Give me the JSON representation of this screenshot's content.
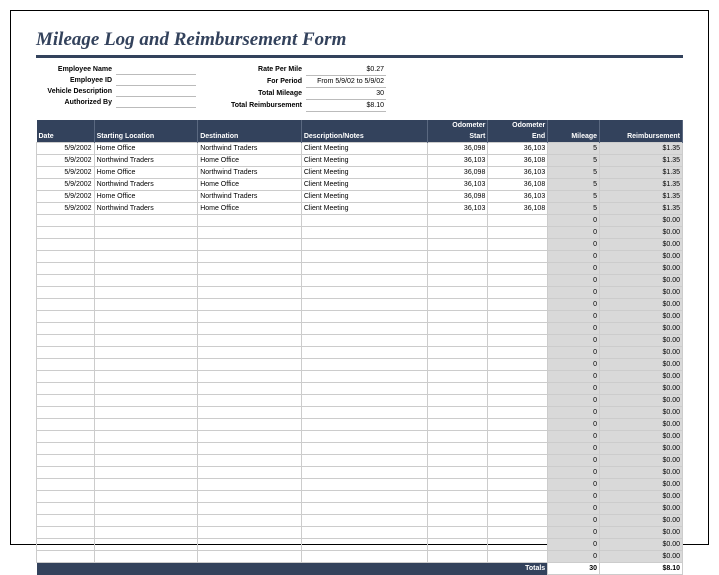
{
  "title": "Mileage Log and Reimbursement Form",
  "labels": {
    "employee_name": "Employee Name",
    "employee_id": "Employee ID",
    "vehicle_description": "Vehicle Description",
    "authorized_by": "Authorized By",
    "rate_per_mile": "Rate Per Mile",
    "for_period": "For Period",
    "total_mileage": "Total Mileage",
    "total_reimbursement": "Total Reimbursement"
  },
  "values": {
    "employee_name": "",
    "employee_id": "",
    "vehicle_description": "",
    "authorized_by": "",
    "rate_per_mile": "$0.27",
    "for_period": "From 5/9/02 to 5/9/02",
    "total_mileage": "30",
    "total_reimbursement": "$8.10"
  },
  "columns": {
    "date": "Date",
    "start": "Starting Location",
    "dest": "Destination",
    "desc": "Description/Notes",
    "ostart": "Odometer Start",
    "oend": "Odometer End",
    "mileage": "Mileage",
    "reimb": "Reimbursement"
  },
  "rows": [
    {
      "date": "5/9/2002",
      "start": "Home Office",
      "dest": "Northwind Traders",
      "desc": "Client Meeting",
      "ostart": "36,098",
      "oend": "36,103",
      "mileage": "5",
      "reimb": "$1.35"
    },
    {
      "date": "5/9/2002",
      "start": "Northwind Traders",
      "dest": "Home Office",
      "desc": "Client Meeting",
      "ostart": "36,103",
      "oend": "36,108",
      "mileage": "5",
      "reimb": "$1.35"
    },
    {
      "date": "5/9/2002",
      "start": "Home Office",
      "dest": "Northwind Traders",
      "desc": "Client Meeting",
      "ostart": "36,098",
      "oend": "36,103",
      "mileage": "5",
      "reimb": "$1.35"
    },
    {
      "date": "5/9/2002",
      "start": "Northwind Traders",
      "dest": "Home Office",
      "desc": "Client Meeting",
      "ostart": "36,103",
      "oend": "36,108",
      "mileage": "5",
      "reimb": "$1.35"
    },
    {
      "date": "5/9/2002",
      "start": "Home Office",
      "dest": "Northwind Traders",
      "desc": "Client Meeting",
      "ostart": "36,098",
      "oend": "36,103",
      "mileage": "5",
      "reimb": "$1.35"
    },
    {
      "date": "5/9/2002",
      "start": "Northwind Traders",
      "dest": "Home Office",
      "desc": "Client Meeting",
      "ostart": "36,103",
      "oend": "36,108",
      "mileage": "5",
      "reimb": "$1.35"
    },
    {
      "date": "",
      "start": "",
      "dest": "",
      "desc": "",
      "ostart": "",
      "oend": "",
      "mileage": "0",
      "reimb": "$0.00"
    },
    {
      "date": "",
      "start": "",
      "dest": "",
      "desc": "",
      "ostart": "",
      "oend": "",
      "mileage": "0",
      "reimb": "$0.00"
    },
    {
      "date": "",
      "start": "",
      "dest": "",
      "desc": "",
      "ostart": "",
      "oend": "",
      "mileage": "0",
      "reimb": "$0.00"
    },
    {
      "date": "",
      "start": "",
      "dest": "",
      "desc": "",
      "ostart": "",
      "oend": "",
      "mileage": "0",
      "reimb": "$0.00"
    },
    {
      "date": "",
      "start": "",
      "dest": "",
      "desc": "",
      "ostart": "",
      "oend": "",
      "mileage": "0",
      "reimb": "$0.00"
    },
    {
      "date": "",
      "start": "",
      "dest": "",
      "desc": "",
      "ostart": "",
      "oend": "",
      "mileage": "0",
      "reimb": "$0.00"
    },
    {
      "date": "",
      "start": "",
      "dest": "",
      "desc": "",
      "ostart": "",
      "oend": "",
      "mileage": "0",
      "reimb": "$0.00"
    },
    {
      "date": "",
      "start": "",
      "dest": "",
      "desc": "",
      "ostart": "",
      "oend": "",
      "mileage": "0",
      "reimb": "$0.00"
    },
    {
      "date": "",
      "start": "",
      "dest": "",
      "desc": "",
      "ostart": "",
      "oend": "",
      "mileage": "0",
      "reimb": "$0.00"
    },
    {
      "date": "",
      "start": "",
      "dest": "",
      "desc": "",
      "ostart": "",
      "oend": "",
      "mileage": "0",
      "reimb": "$0.00"
    },
    {
      "date": "",
      "start": "",
      "dest": "",
      "desc": "",
      "ostart": "",
      "oend": "",
      "mileage": "0",
      "reimb": "$0.00"
    },
    {
      "date": "",
      "start": "",
      "dest": "",
      "desc": "",
      "ostart": "",
      "oend": "",
      "mileage": "0",
      "reimb": "$0.00"
    },
    {
      "date": "",
      "start": "",
      "dest": "",
      "desc": "",
      "ostart": "",
      "oend": "",
      "mileage": "0",
      "reimb": "$0.00"
    },
    {
      "date": "",
      "start": "",
      "dest": "",
      "desc": "",
      "ostart": "",
      "oend": "",
      "mileage": "0",
      "reimb": "$0.00"
    },
    {
      "date": "",
      "start": "",
      "dest": "",
      "desc": "",
      "ostart": "",
      "oend": "",
      "mileage": "0",
      "reimb": "$0.00"
    },
    {
      "date": "",
      "start": "",
      "dest": "",
      "desc": "",
      "ostart": "",
      "oend": "",
      "mileage": "0",
      "reimb": "$0.00"
    },
    {
      "date": "",
      "start": "",
      "dest": "",
      "desc": "",
      "ostart": "",
      "oend": "",
      "mileage": "0",
      "reimb": "$0.00"
    },
    {
      "date": "",
      "start": "",
      "dest": "",
      "desc": "",
      "ostart": "",
      "oend": "",
      "mileage": "0",
      "reimb": "$0.00"
    },
    {
      "date": "",
      "start": "",
      "dest": "",
      "desc": "",
      "ostart": "",
      "oend": "",
      "mileage": "0",
      "reimb": "$0.00"
    },
    {
      "date": "",
      "start": "",
      "dest": "",
      "desc": "",
      "ostart": "",
      "oend": "",
      "mileage": "0",
      "reimb": "$0.00"
    },
    {
      "date": "",
      "start": "",
      "dest": "",
      "desc": "",
      "ostart": "",
      "oend": "",
      "mileage": "0",
      "reimb": "$0.00"
    },
    {
      "date": "",
      "start": "",
      "dest": "",
      "desc": "",
      "ostart": "",
      "oend": "",
      "mileage": "0",
      "reimb": "$0.00"
    },
    {
      "date": "",
      "start": "",
      "dest": "",
      "desc": "",
      "ostart": "",
      "oend": "",
      "mileage": "0",
      "reimb": "$0.00"
    },
    {
      "date": "",
      "start": "",
      "dest": "",
      "desc": "",
      "ostart": "",
      "oend": "",
      "mileage": "0",
      "reimb": "$0.00"
    },
    {
      "date": "",
      "start": "",
      "dest": "",
      "desc": "",
      "ostart": "",
      "oend": "",
      "mileage": "0",
      "reimb": "$0.00"
    },
    {
      "date": "",
      "start": "",
      "dest": "",
      "desc": "",
      "ostart": "",
      "oend": "",
      "mileage": "0",
      "reimb": "$0.00"
    },
    {
      "date": "",
      "start": "",
      "dest": "",
      "desc": "",
      "ostart": "",
      "oend": "",
      "mileage": "0",
      "reimb": "$0.00"
    },
    {
      "date": "",
      "start": "",
      "dest": "",
      "desc": "",
      "ostart": "",
      "oend": "",
      "mileage": "0",
      "reimb": "$0.00"
    },
    {
      "date": "",
      "start": "",
      "dest": "",
      "desc": "",
      "ostart": "",
      "oend": "",
      "mileage": "0",
      "reimb": "$0.00"
    }
  ],
  "totals": {
    "label": "Totals",
    "mileage": "30",
    "reimb": "$8.10"
  }
}
